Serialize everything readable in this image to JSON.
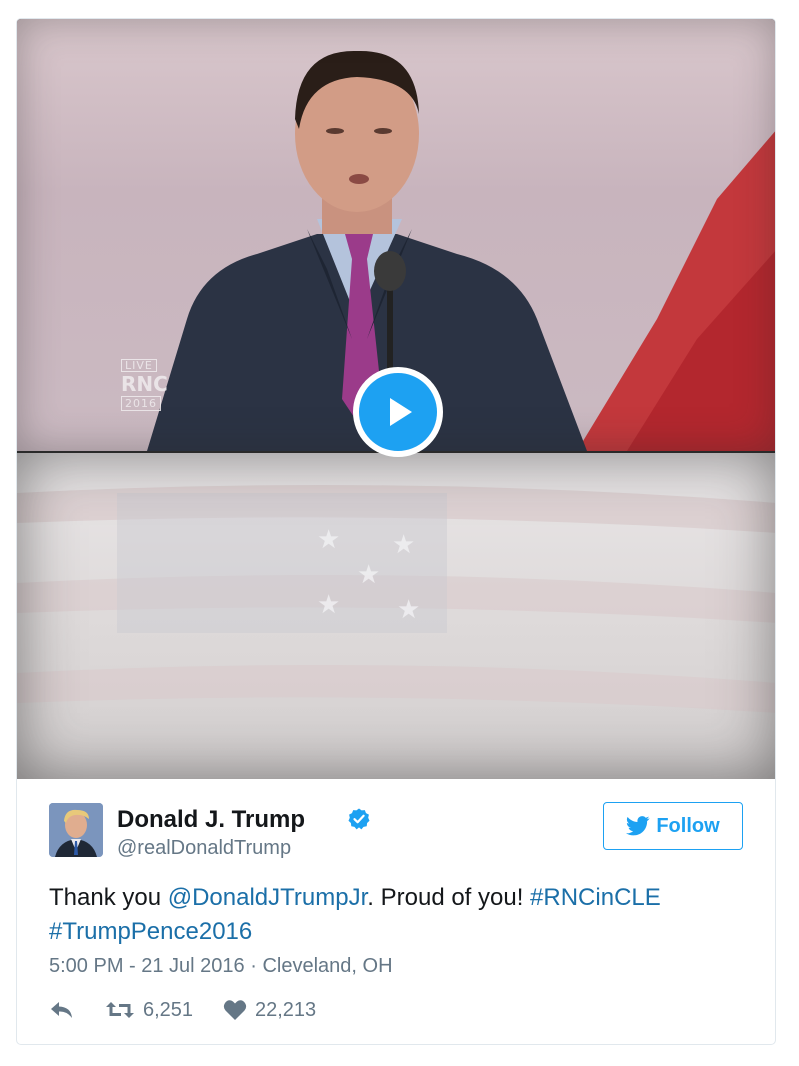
{
  "video": {
    "overlay": {
      "live": "LIVE",
      "rnc": "RNC",
      "year": "2016"
    },
    "play_icon": "play-icon"
  },
  "author": {
    "name": "Donald J. Trump",
    "handle": "@realDonaldTrump",
    "verified_icon": "verified-badge-icon"
  },
  "follow_button": {
    "label": "Follow",
    "icon": "twitter-bird-icon"
  },
  "tweet": {
    "text_1": "Thank you ",
    "mention": "@DonaldJTrumpJr",
    "text_2": ". Proud of you! ",
    "hashtag_1": "#RNCinCLE",
    "hashtag_2": "#TrumpPence2016"
  },
  "meta": {
    "timestamp": "5:00 PM - 21 Jul 2016",
    "separator": " · ",
    "location": "Cleveland, OH"
  },
  "actions": {
    "reply_icon": "reply-icon",
    "retweet_icon": "retweet-icon",
    "retweet_count": "6,251",
    "like_icon": "heart-icon",
    "like_count": "22,213"
  },
  "colors": {
    "link": "#1b6fa8",
    "accent": "#1da1f2",
    "text": "#14171a",
    "muted": "#657786"
  }
}
